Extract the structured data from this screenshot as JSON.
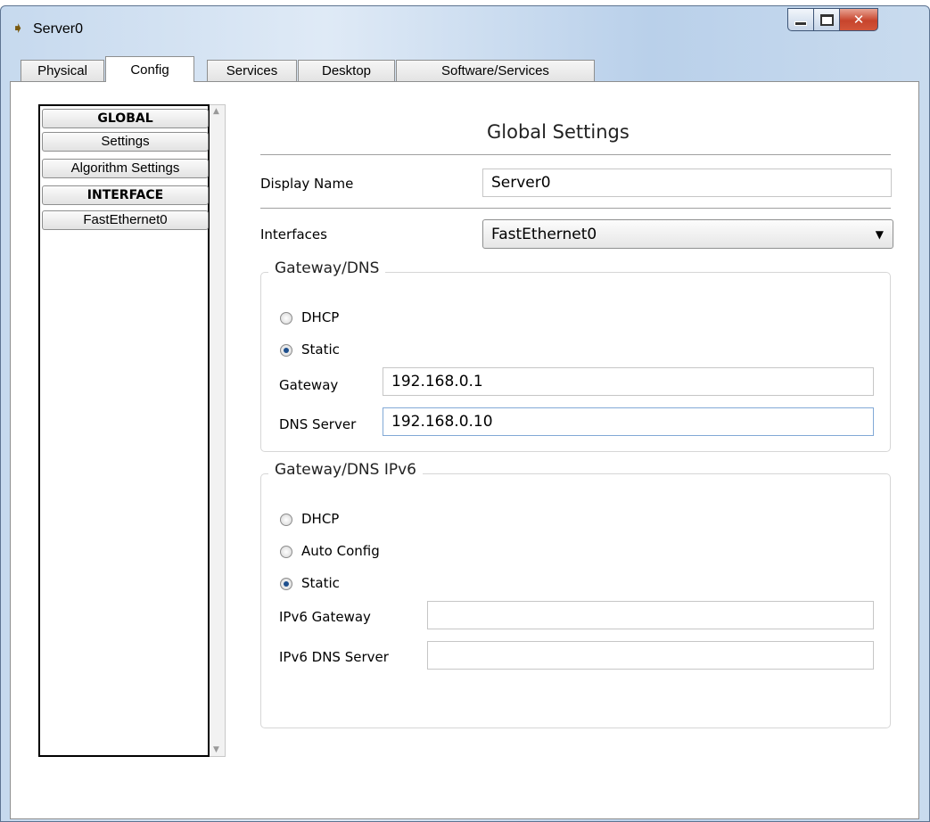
{
  "window": {
    "title": "Server0"
  },
  "tabs": [
    {
      "label": "Physical"
    },
    {
      "label": "Config"
    },
    {
      "label": "Services"
    },
    {
      "label": "Desktop"
    },
    {
      "label": "Software/Services"
    }
  ],
  "sidebar": {
    "items": [
      {
        "label": "GLOBAL"
      },
      {
        "label": "Settings"
      },
      {
        "label": "Algorithm Settings"
      },
      {
        "label": "INTERFACE"
      },
      {
        "label": "FastEthernet0"
      }
    ]
  },
  "main": {
    "heading": "Global Settings",
    "display_name": {
      "label": "Display Name",
      "value": "Server0"
    },
    "interfaces": {
      "label": "Interfaces",
      "value": "FastEthernet0"
    },
    "gateway_dns": {
      "title": "Gateway/DNS",
      "dhcp_label": "DHCP",
      "static_label": "Static",
      "gateway": {
        "label": "Gateway",
        "value": "192.168.0.1"
      },
      "dns": {
        "label": "DNS Server",
        "value": "192.168.0.10"
      }
    },
    "gateway_dns_ipv6": {
      "title": "Gateway/DNS IPv6",
      "dhcp_label": "DHCP",
      "auto_label": "Auto Config",
      "static_label": "Static",
      "gateway": {
        "label": "IPv6 Gateway",
        "value": ""
      },
      "dns": {
        "label": "IPv6 DNS Server",
        "value": ""
      }
    }
  },
  "colors": {
    "accent": "#1e4f8d",
    "close_button": "#c7442c"
  }
}
